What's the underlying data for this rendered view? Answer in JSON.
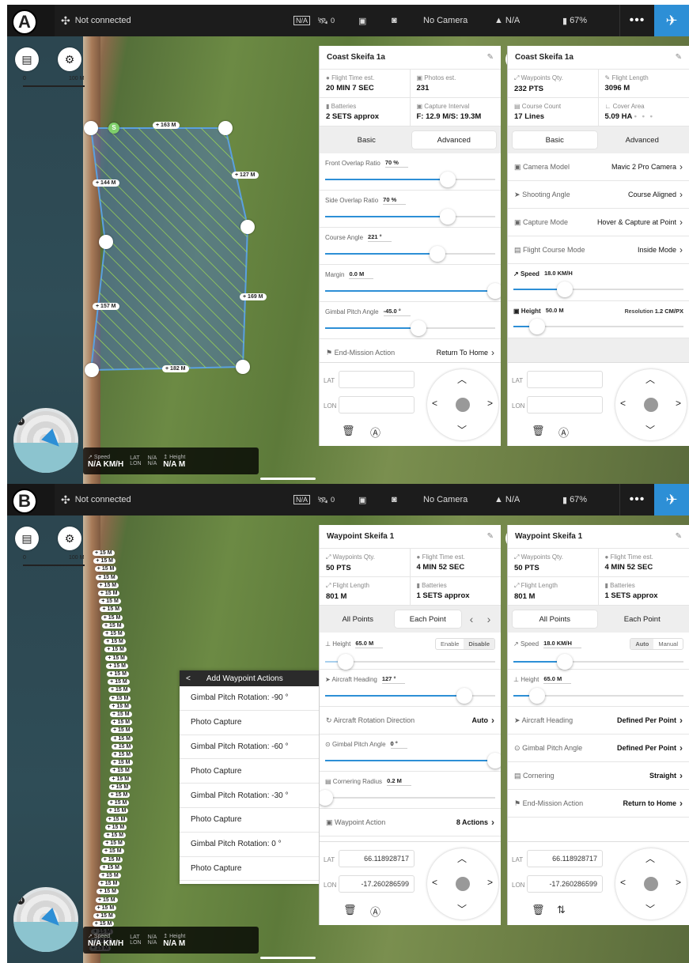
{
  "panels_labels": {
    "a": "A",
    "b": "B"
  },
  "topbar": {
    "connection": "Not connected",
    "na_box": "N/A",
    "satellites": "0",
    "camera": "No Camera",
    "signal": "N/A",
    "battery": "67%",
    "more": "•••"
  },
  "map": {
    "toggle_label": "2D",
    "scale_start": "0",
    "scale_end": "100 M"
  },
  "telemetry": {
    "speed_label": "Speed",
    "speed_value": "N/A KM/H",
    "lat_label": "LAT",
    "lon_label": "LON",
    "lat_value": "N/A",
    "lon_value": "N/A",
    "height_label": "Height",
    "height_value": "N/A M"
  },
  "secA": {
    "start_marker": "S",
    "distances": [
      "163 M",
      "144 M",
      "127 M",
      "157 M",
      "169 M",
      "182 M"
    ],
    "left_panel": {
      "title": "Coast Skeifa 1a",
      "stats": [
        {
          "label": "Flight Time est.",
          "value": "20 MIN 7 SEC"
        },
        {
          "label": "Photos est.",
          "value": "231"
        },
        {
          "label": "Batteries",
          "value": "2 SETS approx"
        },
        {
          "label": "Capture Interval",
          "value": "F: 12.9 M/S: 19.3M"
        }
      ],
      "tab_basic": "Basic",
      "tab_advanced": "Advanced",
      "sliders": [
        {
          "label": "Front Overlap Ratio",
          "value": "70 %",
          "pos": 0.72
        },
        {
          "label": "Side Overlap Ratio",
          "value": "70 %",
          "pos": 0.72
        },
        {
          "label": "Course Angle",
          "value": "221 °",
          "pos": 0.66
        },
        {
          "label": "Margin",
          "value": "0.0 M",
          "pos": 1.0
        },
        {
          "label": "Gimbal Pitch Angle",
          "value": "-45.0 °",
          "pos": 0.55
        }
      ],
      "end_label": "End-Mission Action",
      "end_value": "Return To Home",
      "lat": "LAT",
      "lon": "LON"
    },
    "right_panel": {
      "title": "Coast Skeifa 1a",
      "stats": [
        {
          "label": "Waypoints Qty.",
          "value": "232 PTS"
        },
        {
          "label": "Flight Length",
          "value": "3096 M"
        },
        {
          "label": "Course Count",
          "value": "17 Lines"
        },
        {
          "label": "Cover Area",
          "value": "5.09 HA"
        }
      ],
      "tab_basic": "Basic",
      "tab_advanced": "Advanced",
      "rows": [
        {
          "label": "Camera Model",
          "value": "Mavic 2 Pro Camera"
        },
        {
          "label": "Shooting Angle",
          "value": "Course Aligned"
        },
        {
          "label": "Capture Mode",
          "value": "Hover & Capture at Point"
        },
        {
          "label": "Flight Course Mode",
          "value": "Inside Mode"
        }
      ],
      "speed_label": "Speed",
      "speed_value": "18.0 KM/H",
      "speed_pos": 0.3,
      "height_label": "Height",
      "height_value": "50.0 M",
      "resolution_label": "Resolution",
      "resolution_value": "1.2 CM/PX",
      "height_pos": 0.14,
      "lat": "LAT",
      "lon": "LON"
    }
  },
  "secB": {
    "waypoint_label": "15 M",
    "actions_menu": {
      "back": "<",
      "title": "Add Waypoint Actions",
      "items": [
        "Gimbal Pitch Rotation: -90 °",
        "Photo Capture",
        "Gimbal Pitch Rotation: -60 °",
        "Photo Capture",
        "Gimbal Pitch Rotation: -30 °",
        "Photo Capture",
        "Gimbal Pitch Rotation: 0 °",
        "Photo Capture"
      ]
    },
    "left_panel": {
      "title": "Waypoint Skeifa 1",
      "stats": [
        {
          "label": "Waypoints Qty.",
          "value": "50 PTS"
        },
        {
          "label": "Flight Time est.",
          "value": "4 MIN 52 SEC"
        },
        {
          "label": "Flight Length",
          "value": "801 M"
        },
        {
          "label": "Batteries",
          "value": "1 SETS approx"
        }
      ],
      "tab_all": "All Points",
      "tab_each": "Each Point",
      "prev": "‹",
      "next": "›",
      "height_label": "Height",
      "height_value": "65.0 M",
      "enable": "Enable",
      "disable": "Disable",
      "height_pos": 0.12,
      "heading_label": "Aircraft Heading",
      "heading_value": "127 °",
      "heading_pos": 0.82,
      "rotation_label": "Aircraft Rotation Direction",
      "rotation_value": "Auto",
      "gimbal_label": "Gimbal Pitch Angle",
      "gimbal_value": "0 °",
      "gimbal_pos": 1.0,
      "corner_label": "Cornering Radius",
      "corner_value": "0.2 M",
      "corner_pos": 0.0,
      "action_label": "Waypoint Action",
      "action_value": "8 Actions",
      "lat": "LAT",
      "lon": "LON",
      "lat_value": "66.118928717",
      "lon_value": "-17.260286599"
    },
    "right_panel": {
      "title": "Waypoint Skeifa 1",
      "stats": [
        {
          "label": "Waypoints Qty.",
          "value": "50 PTS"
        },
        {
          "label": "Flight Time est.",
          "value": "4 MIN 52 SEC"
        },
        {
          "label": "Flight Length",
          "value": "801 M"
        },
        {
          "label": "Batteries",
          "value": "1 SETS approx"
        }
      ],
      "tab_all": "All Points",
      "tab_each": "Each Point",
      "speed_label": "Speed",
      "speed_value": "18.0 KM/H",
      "auto": "Auto",
      "manual": "Manual",
      "speed_pos": 0.3,
      "height_label": "Height",
      "height_value": "65.0 M",
      "height_pos": 0.14,
      "rows": [
        {
          "label": "Aircraft Heading",
          "value": "Defined Per Point"
        },
        {
          "label": "Gimbal Pitch Angle",
          "value": "Defined Per Point"
        },
        {
          "label": "Cornering",
          "value": "Straight"
        },
        {
          "label": "End-Mission Action",
          "value": "Return to Home"
        }
      ],
      "lat": "LAT",
      "lon": "LON",
      "lat_value": "66.118928717",
      "lon_value": "-17.260286599"
    }
  },
  "colors": {
    "accent": "#2d8fd6",
    "polygon": "#9fdc52"
  }
}
